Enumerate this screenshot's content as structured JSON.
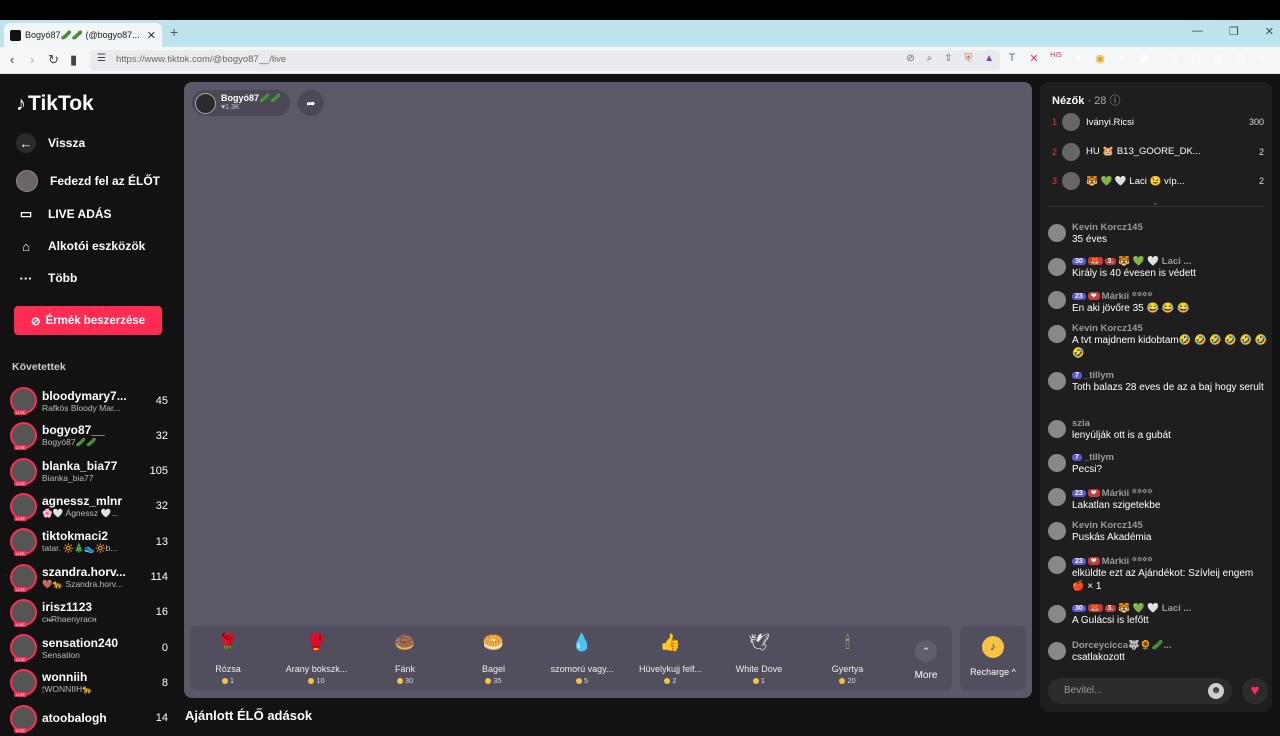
{
  "browser": {
    "tab_title": "Bogyó87🥒🥒 (@bogyo87...",
    "url": "https://www.tiktok.com/@bogyo87__/live",
    "new_tab": "+",
    "close_tab": "✕"
  },
  "sidebar": {
    "logo": "TikTok",
    "nav": [
      {
        "label": "Vissza",
        "icon": "back-arrow-icon"
      },
      {
        "label": "Fedezd fel az ÉLŐT",
        "icon": "avatar"
      },
      {
        "label": "LIVE ADÁS",
        "icon": "video-camera-icon"
      },
      {
        "label": "Alkotói eszközök",
        "icon": "home-icon"
      },
      {
        "label": "Több",
        "icon": "ellipsis-icon"
      }
    ],
    "coin_button": "Érmék beszerzése",
    "following_title": "Követettek",
    "following": [
      {
        "user": "bloodymary7...",
        "display": "Rafkós Bloody Mar...",
        "count": "45"
      },
      {
        "user": "bogyo87__",
        "display": "Bogyó87🥒🥒",
        "count": "32"
      },
      {
        "user": "blanka_bia77",
        "display": "Bianka_bia77",
        "count": "105"
      },
      {
        "user": "agnessz_mlnr",
        "display": "🌸🤍 Ágnessz 🤍...",
        "count": "32"
      },
      {
        "user": "tiktokmaci2",
        "display": "tatar. 🔆🎄👟🔆b...",
        "count": "13"
      },
      {
        "user": "szandra.horv...",
        "display": "🤎🐆 Szandra.horv...",
        "count": "114"
      },
      {
        "user": "irisz1123",
        "display": "сн̶Rhaenyraсн",
        "count": "16"
      },
      {
        "user": "sensation240",
        "display": "Sensation",
        "count": "0"
      },
      {
        "user": "wonniih",
        "display": "🕯WONNIIH🐆",
        "count": "8"
      },
      {
        "user": "atoobalogh",
        "display": "",
        "count": "14"
      }
    ],
    "live_tag": "LIVE"
  },
  "stage": {
    "host_name": "Bogyó87🥒🥒",
    "host_likes": "♥1.3K",
    "gifts": [
      {
        "name": "Rózsa",
        "price": "1",
        "icon": "🌹",
        "color": "#e84a6a"
      },
      {
        "name": "Arany bokszk...",
        "price": "10",
        "icon": "🥊",
        "color": "#f5d26b"
      },
      {
        "name": "Fánk",
        "price": "30",
        "icon": "🍩",
        "color": "#f29ab6"
      },
      {
        "name": "Bagel",
        "price": "35",
        "icon": "🥯",
        "color": "#d99a3c"
      },
      {
        "name": "szomorú vagy...",
        "price": "5",
        "icon": "💧",
        "color": "#6b6fd8"
      },
      {
        "name": "Hüvelykujj felf...",
        "price": "2",
        "icon": "👍",
        "color": "#f0a040"
      },
      {
        "name": "White Dove",
        "price": "1",
        "icon": "🕊",
        "color": "#e8e8e8"
      },
      {
        "name": "Gyertya",
        "price": "20",
        "icon": "🕯",
        "color": "#f3d9a0"
      }
    ],
    "more": "More",
    "recharge": "Recharge ^",
    "recommended": "Ajánlott ÉLŐ adások"
  },
  "viewers": {
    "title": "Nézők",
    "count": "· 28",
    "top": [
      {
        "rank": "1",
        "name": "Iványi.Ricsi",
        "score": "300"
      },
      {
        "rank": "2",
        "name": "HU 🐹 B13_GOORE_DK...",
        "score": "2"
      },
      {
        "rank": "3",
        "name": "🐯 💚 🤍 Laci 😉 víp...",
        "score": "2"
      }
    ]
  },
  "chat": [
    {
      "badges": [],
      "user": "Kevin Korcz145",
      "msg": "35 éves"
    },
    {
      "badges": [
        "30",
        "🦊",
        "3."
      ],
      "user": "🐯 💚 🤍 Laci ...",
      "msg": "Király is 40 évesen is védett"
    },
    {
      "badges": [
        "23",
        "❤"
      ],
      "user": "Márkii ꙳꙳꙳꙳",
      "msg": "En aki jövőre 35 😂 😂 😂"
    },
    {
      "badges": [],
      "user": "Kevin Korcz145",
      "msg": "A tvt majdnem kidobtam🤣 🤣 🤣 🤣 🤣 🤣 🤣"
    },
    {
      "badges": [
        "7"
      ],
      "user": "_tillym",
      "msg": "Toth balazs 28 eves de az a baj hogy serult"
    },
    {
      "badges": [],
      "user": "szia",
      "msg": "lenyúlják ott is a gubát"
    },
    {
      "badges": [
        "7"
      ],
      "user": "_tillym",
      "msg": "Pecsi?"
    },
    {
      "badges": [
        "23",
        "❤"
      ],
      "user": "Márkii ꙳꙳꙳꙳",
      "msg": "Lakatlan szigetekbe"
    },
    {
      "badges": [],
      "user": "Kevin Korcz145",
      "msg": "Puskás Akadémia"
    },
    {
      "badges": [
        "23",
        "❤"
      ],
      "user": "Márkii ꙳꙳꙳꙳",
      "msg": "elküldte ezt az Ajándékot: Szívleij engem 🍎 × 1"
    },
    {
      "badges": [
        "30",
        "🦊",
        "3."
      ],
      "user": "🐯 💚 🤍 Laci ...",
      "msg": "A Gulácsi is lefőtt"
    },
    {
      "badges": [],
      "user": "Dorceycicca🐺🌻🥒...",
      "msg": "csatlakozott"
    }
  ],
  "input": {
    "placeholder": "Bevitel..."
  },
  "colors": {
    "accent": "#fe2c55",
    "stage_bg": "#5b5868",
    "panel_bg": "#1e1e1e"
  }
}
